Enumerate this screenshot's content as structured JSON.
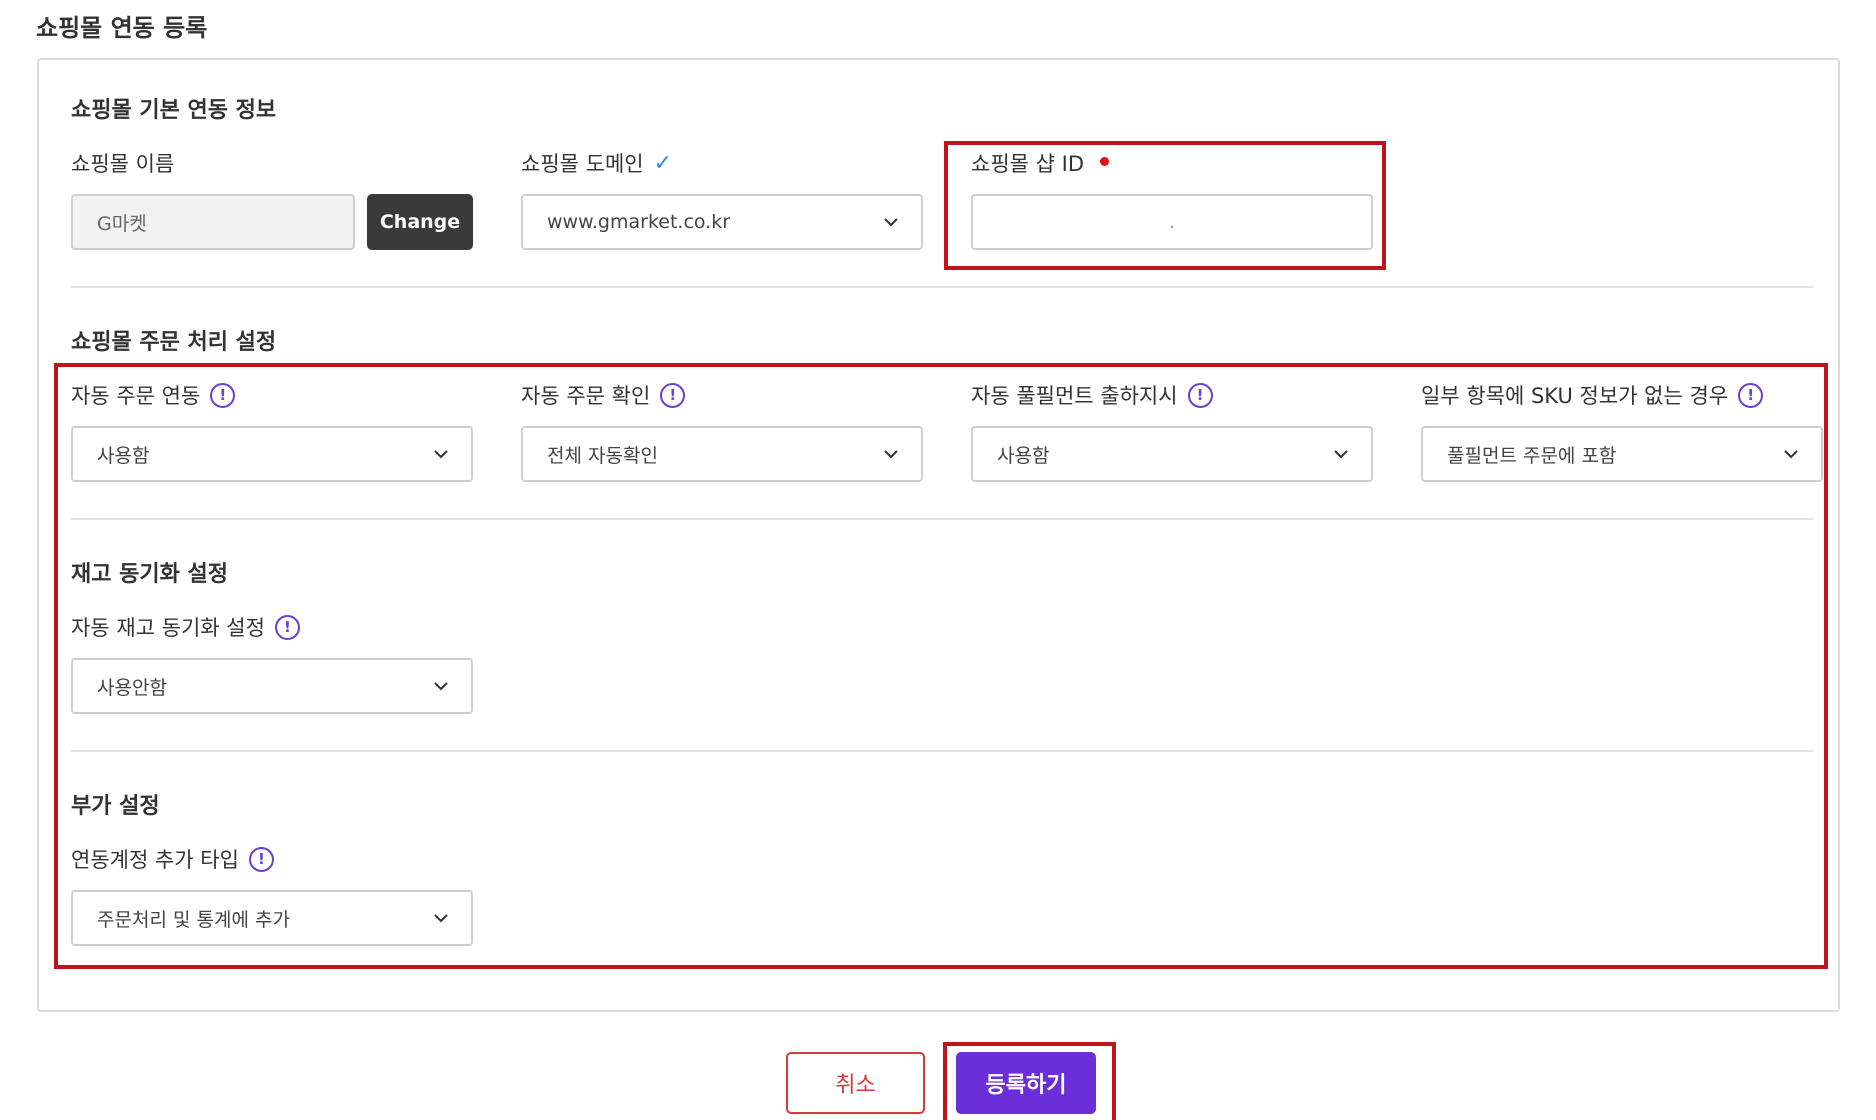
{
  "page": {
    "title": "쇼핑몰 연동 등록"
  },
  "basic": {
    "title": "쇼핑몰 기본 연동 정보",
    "mall_name": {
      "label": "쇼핑몰 이름",
      "value": "G마켓",
      "change_label": "Change"
    },
    "mall_domain": {
      "label": "쇼핑몰 도메인",
      "value": "www.gmarket.co.kr",
      "icon": "check-icon"
    },
    "shop_id": {
      "label": "쇼핑몰 샵 ID",
      "value": ".",
      "required": true
    }
  },
  "order": {
    "title": "쇼핑몰 주문 처리 설정",
    "fields": [
      {
        "label": "자동 주문 연동",
        "value": "사용함"
      },
      {
        "label": "자동 주문 확인",
        "value": "전체 자동확인"
      },
      {
        "label": "자동 풀필먼트 출하지시",
        "value": "사용함"
      },
      {
        "label": "일부 항목에 SKU 정보가 없는 경우",
        "value": "풀필먼트 주문에 포함"
      }
    ]
  },
  "inventory": {
    "title": "재고 동기화 설정",
    "field": {
      "label": "자동 재고 동기화 설정",
      "value": "사용안함"
    }
  },
  "extra": {
    "title": "부가 설정",
    "field": {
      "label": "연동계정 추가 타입",
      "value": "주문처리 및 통계에 추가"
    }
  },
  "actions": {
    "cancel_label": "취소",
    "submit_label": "등록하기"
  },
  "colors": {
    "accent": "#6a2fd8",
    "highlight": "#c0141c",
    "cancel": "#d63a3a",
    "info": "#6a3fd6",
    "check": "#2f8fe0"
  }
}
